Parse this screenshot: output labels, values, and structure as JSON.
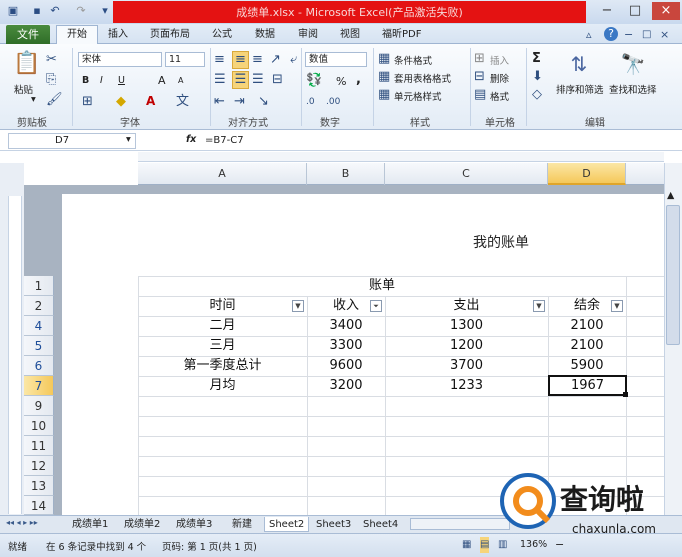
{
  "window": {
    "title": "成绩单.xlsx - Microsoft Excel(产品激活失败)"
  },
  "menu_tabs": [
    "文件",
    "开始",
    "插入",
    "页面布局",
    "公式",
    "数据",
    "审阅",
    "视图",
    "福昕PDF"
  ],
  "ribbon": {
    "clipboard": {
      "paste": "粘贴",
      "label": "剪贴板"
    },
    "font": {
      "name": "宋体",
      "size": "11",
      "bold": "B",
      "italic": "I",
      "underline": "U",
      "grow": "A",
      "shrink": "A",
      "label": "字体"
    },
    "alignment": {
      "label": "对齐方式"
    },
    "number": {
      "format": "数值",
      "percent": "%",
      "comma": ",",
      "label": "数字"
    },
    "styles": {
      "conditional": "条件格式",
      "table": "套用表格格式",
      "cell_styles": "单元格样式",
      "label": "样式"
    },
    "cells": {
      "insert": "插入",
      "delete": "删除",
      "format": "格式",
      "label": "单元格"
    },
    "editing": {
      "sum": "Σ",
      "sort_filter": "排序和筛选",
      "find_select": "查找和选择",
      "label": "编辑"
    }
  },
  "formula_bar": {
    "cell_ref": "D7",
    "fx": "fx",
    "formula": "=B7-C7"
  },
  "columns": [
    "A",
    "B",
    "C",
    "D"
  ],
  "rows": [
    "1",
    "2",
    "4",
    "5",
    "6",
    "7",
    "9",
    "10",
    "11",
    "12",
    "13",
    "14"
  ],
  "sheet": {
    "page_header": "我的账单",
    "table_title": "账单",
    "headers": [
      "时间",
      "收入",
      "支出",
      "结余"
    ],
    "data": [
      [
        "二月",
        "3400",
        "1300",
        "2100"
      ],
      [
        "三月",
        "3300",
        "1200",
        "2100"
      ],
      [
        "第一季度总计",
        "9600",
        "3700",
        "5900"
      ],
      [
        "月均",
        "3200",
        "1233",
        "1967"
      ]
    ]
  },
  "sheet_tabs": [
    "成绩单1",
    "成绩单2",
    "成绩单3",
    "新建",
    "Sheet2",
    "Sheet3",
    "Sheet4"
  ],
  "status": {
    "mode": "就绪",
    "filter_info": "在 6 条记录中找到 4 个",
    "page": "页码: 第 1 页(共 1 页)",
    "zoom": "136%",
    "minus": "−"
  },
  "watermark": {
    "brand": "查询啦",
    "url": "chaxunla.com"
  }
}
